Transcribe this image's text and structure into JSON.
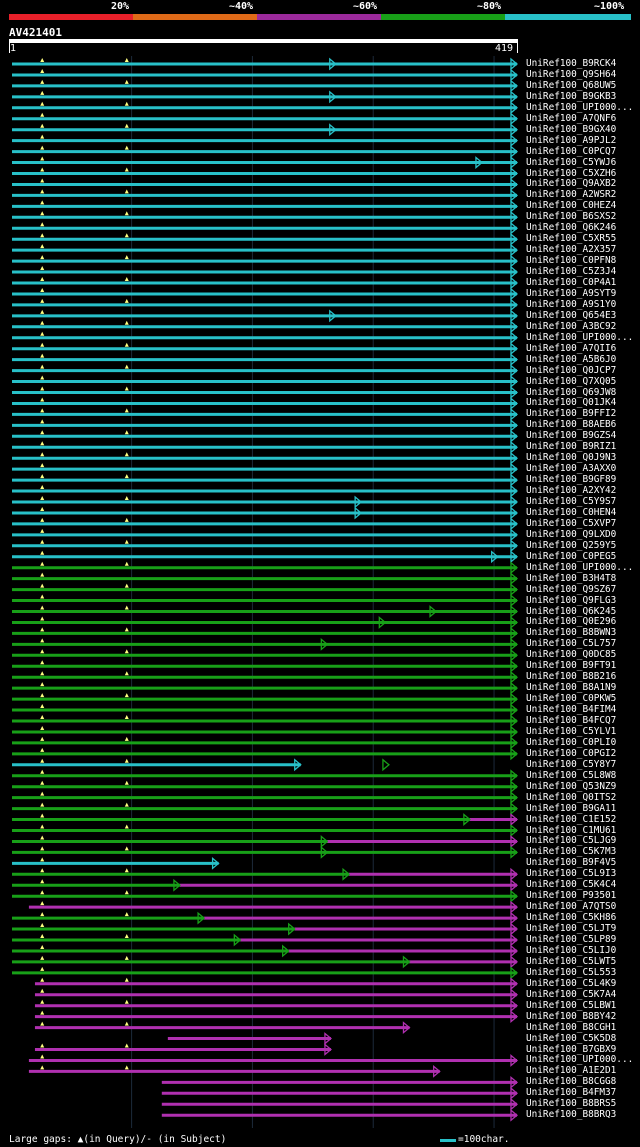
{
  "legend": {
    "percent_labels": [
      "20%",
      "~40%",
      "~60%",
      "~80%",
      "~100%"
    ],
    "band_colors": [
      "#e8202a",
      "#e06a18",
      "#9c2a9c",
      "#18a018",
      "#28c0c8"
    ]
  },
  "query": {
    "name": "AV421401",
    "start": "1",
    "end": "419"
  },
  "footer": {
    "gap_text": "Large gaps: ▲(in Query)/- (in Subject)",
    "scale_text": "=100char."
  },
  "chart_data": {
    "type": "alignment-overview",
    "query_length": 419,
    "hits": [
      {
        "name": "UniRef100_B9RCK4",
        "color": "cyan",
        "start": 1,
        "end": 419,
        "mid": 269
      },
      {
        "name": "UniRef100_Q9SH64",
        "color": "cyan",
        "start": 1,
        "end": 419
      },
      {
        "name": "UniRef100_Q68UW5",
        "color": "cyan",
        "start": 1,
        "end": 419
      },
      {
        "name": "UniRef100_B9GKB3",
        "color": "cyan",
        "start": 1,
        "end": 419,
        "mid": 269
      },
      {
        "name": "UniRef100_UPI000...",
        "color": "cyan",
        "start": 1,
        "end": 419
      },
      {
        "name": "UniRef100_A7QNF6",
        "color": "cyan",
        "start": 1,
        "end": 419
      },
      {
        "name": "UniRef100_B9GX40",
        "color": "cyan",
        "start": 1,
        "end": 419,
        "mid": 269
      },
      {
        "name": "UniRef100_A9PJL2",
        "color": "cyan",
        "start": 1,
        "end": 419
      },
      {
        "name": "UniRef100_C0PCQ7",
        "color": "cyan",
        "start": 1,
        "end": 419
      },
      {
        "name": "UniRef100_C5YWJ6",
        "color": "cyan",
        "start": 1,
        "end": 419,
        "mid": 390
      },
      {
        "name": "UniRef100_C5XZH6",
        "color": "cyan",
        "start": 1,
        "end": 419
      },
      {
        "name": "UniRef100_Q9AXB2",
        "color": "cyan",
        "start": 1,
        "end": 419
      },
      {
        "name": "UniRef100_A2WSR2",
        "color": "cyan",
        "start": 1,
        "end": 419
      },
      {
        "name": "UniRef100_C0HEZ4",
        "color": "cyan",
        "start": 1,
        "end": 419
      },
      {
        "name": "UniRef100_B6SXS2",
        "color": "cyan",
        "start": 1,
        "end": 419
      },
      {
        "name": "UniRef100_Q6K246",
        "color": "cyan",
        "start": 1,
        "end": 419
      },
      {
        "name": "UniRef100_C5XR55",
        "color": "cyan",
        "start": 1,
        "end": 419
      },
      {
        "name": "UniRef100_A2X357",
        "color": "cyan",
        "start": 1,
        "end": 419
      },
      {
        "name": "UniRef100_C0PFN8",
        "color": "cyan",
        "start": 1,
        "end": 419
      },
      {
        "name": "UniRef100_C5Z3J4",
        "color": "cyan",
        "start": 1,
        "end": 419
      },
      {
        "name": "UniRef100_C0P4A1",
        "color": "cyan",
        "start": 1,
        "end": 419
      },
      {
        "name": "UniRef100_A9SYT9",
        "color": "cyan",
        "start": 1,
        "end": 419
      },
      {
        "name": "UniRef100_A9S1Y0",
        "color": "cyan",
        "start": 1,
        "end": 419
      },
      {
        "name": "UniRef100_Q654E3",
        "color": "cyan",
        "start": 1,
        "end": 419,
        "mid": 269
      },
      {
        "name": "UniRef100_A3BC92",
        "color": "cyan",
        "start": 1,
        "end": 419
      },
      {
        "name": "UniRef100_UPI000...",
        "color": "cyan",
        "start": 1,
        "end": 419
      },
      {
        "name": "UniRef100_A7QII6",
        "color": "cyan",
        "start": 1,
        "end": 419
      },
      {
        "name": "UniRef100_A5B6J0",
        "color": "cyan",
        "start": 1,
        "end": 419
      },
      {
        "name": "UniRef100_Q0JCP7",
        "color": "cyan",
        "start": 1,
        "end": 419
      },
      {
        "name": "UniRef100_Q7XQ05",
        "color": "cyan",
        "start": 1,
        "end": 419
      },
      {
        "name": "UniRef100_Q69JW8",
        "color": "cyan",
        "start": 1,
        "end": 419
      },
      {
        "name": "UniRef100_Q01JK4",
        "color": "cyan",
        "start": 1,
        "end": 419
      },
      {
        "name": "UniRef100_B9FFI2",
        "color": "cyan",
        "start": 1,
        "end": 419
      },
      {
        "name": "UniRef100_B8AEB6",
        "color": "cyan",
        "start": 1,
        "end": 419
      },
      {
        "name": "UniRef100_B9GZS4",
        "color": "cyan",
        "start": 1,
        "end": 419
      },
      {
        "name": "UniRef100_B9RIZ1",
        "color": "cyan",
        "start": 1,
        "end": 419
      },
      {
        "name": "UniRef100_Q0J9N3",
        "color": "cyan",
        "start": 1,
        "end": 419
      },
      {
        "name": "UniRef100_A3AXX0",
        "color": "cyan",
        "start": 1,
        "end": 419
      },
      {
        "name": "UniRef100_B9GF89",
        "color": "cyan",
        "start": 1,
        "end": 419
      },
      {
        "name": "UniRef100_A2XY42",
        "color": "cyan",
        "start": 1,
        "end": 419
      },
      {
        "name": "UniRef100_C5Y9S7",
        "color": "cyan",
        "start": 1,
        "end": 419,
        "mid": 290
      },
      {
        "name": "UniRef100_C0HEN4",
        "color": "cyan",
        "start": 1,
        "end": 419,
        "mid": 290
      },
      {
        "name": "UniRef100_C5XVP7",
        "color": "cyan",
        "start": 1,
        "end": 419
      },
      {
        "name": "UniRef100_Q9LXD0",
        "color": "cyan",
        "start": 1,
        "end": 419
      },
      {
        "name": "UniRef100_Q259Y5",
        "color": "cyan",
        "start": 1,
        "end": 419
      },
      {
        "name": "UniRef100_C0PEG5",
        "color": "cyan",
        "start": 1,
        "end": 419,
        "mid": 403
      },
      {
        "name": "UniRef100_UPI000...",
        "color": "green",
        "start": 1,
        "end": 419
      },
      {
        "name": "UniRef100_B3H4T8",
        "color": "green",
        "start": 1,
        "end": 419
      },
      {
        "name": "UniRef100_Q9SZ67",
        "color": "green",
        "start": 1,
        "end": 419
      },
      {
        "name": "UniRef100_Q9FLG3",
        "color": "green",
        "start": 1,
        "end": 419
      },
      {
        "name": "UniRef100_Q6K245",
        "color": "green",
        "start": 1,
        "end": 419,
        "mid": 352
      },
      {
        "name": "UniRef100_Q0E296",
        "color": "green",
        "start": 1,
        "end": 419,
        "mid": 310
      },
      {
        "name": "UniRef100_B8BWN3",
        "color": "green",
        "start": 1,
        "end": 419
      },
      {
        "name": "UniRef100_C5L757",
        "color": "green",
        "start": 1,
        "end": 419,
        "mid": 262
      },
      {
        "name": "UniRef100_Q0DC85",
        "color": "green",
        "start": 1,
        "end": 419
      },
      {
        "name": "UniRef100_B9FT91",
        "color": "green",
        "start": 1,
        "end": 419
      },
      {
        "name": "UniRef100_B8B216",
        "color": "green",
        "start": 1,
        "end": 419
      },
      {
        "name": "UniRef100_B8A1N9",
        "color": "green",
        "start": 1,
        "end": 419
      },
      {
        "name": "UniRef100_C0PKW5",
        "color": "green",
        "start": 1,
        "end": 419
      },
      {
        "name": "UniRef100_B4FIM4",
        "color": "green",
        "start": 1,
        "end": 419
      },
      {
        "name": "UniRef100_B4FCQ7",
        "color": "green",
        "start": 1,
        "end": 419
      },
      {
        "name": "UniRef100_C5YLV1",
        "color": "green",
        "start": 1,
        "end": 419
      },
      {
        "name": "UniRef100_C0PLI0",
        "color": "green",
        "start": 1,
        "end": 419
      },
      {
        "name": "UniRef100_C0PGI2",
        "color": "green",
        "start": 1,
        "end": 419
      },
      {
        "name": "UniRef100_C5Y8Y7",
        "color": "cyan",
        "start": 1,
        "end": 240,
        "mid2": 313
      },
      {
        "name": "UniRef100_C5L8W8",
        "color": "green",
        "start": 1,
        "end": 419
      },
      {
        "name": "UniRef100_Q53NZ9",
        "color": "green",
        "start": 1,
        "end": 419
      },
      {
        "name": "UniRef100_Q0ITS2",
        "color": "green",
        "start": 1,
        "end": 419
      },
      {
        "name": "UniRef100_B9GA11",
        "color": "green",
        "start": 1,
        "end": 419
      },
      {
        "name": "UniRef100_C1E152",
        "color": "mix",
        "start": 1,
        "end": 419,
        "mid": 380
      },
      {
        "name": "UniRef100_C1MU61",
        "color": "green",
        "start": 1,
        "end": 419
      },
      {
        "name": "UniRef100_C5LJG9",
        "color": "mix",
        "start": 1,
        "end": 419,
        "mid": 262
      },
      {
        "name": "UniRef100_C5K7M3",
        "color": "green",
        "start": 1,
        "end": 419,
        "mid": 262
      },
      {
        "name": "UniRef100_B9F4V5",
        "color": "cyan",
        "start": 1,
        "end": 172
      },
      {
        "name": "UniRef100_C5L9I3",
        "color": "mix",
        "start": 1,
        "end": 419,
        "mid": 280
      },
      {
        "name": "UniRef100_C5K4C4",
        "color": "mix",
        "start": 1,
        "end": 419,
        "mid": 140
      },
      {
        "name": "UniRef100_P93501",
        "color": "green",
        "start": 1,
        "end": 419
      },
      {
        "name": "UniRef100_A7QTS0",
        "color": "magenta",
        "start": 15,
        "end": 419
      },
      {
        "name": "UniRef100_C5KH86",
        "color": "mix",
        "start": 1,
        "end": 419,
        "mid": 160
      },
      {
        "name": "UniRef100_C5LJT9",
        "color": "mix",
        "start": 1,
        "end": 419,
        "mid": 235
      },
      {
        "name": "UniRef100_C5LP89",
        "color": "mix",
        "start": 1,
        "end": 419,
        "mid": 190
      },
      {
        "name": "UniRef100_C5LIJ0",
        "color": "mix",
        "start": 1,
        "end": 419,
        "mid": 230
      },
      {
        "name": "UniRef100_C5LWT5",
        "color": "mix",
        "start": 1,
        "end": 419,
        "mid": 330
      },
      {
        "name": "UniRef100_C5L553",
        "color": "green",
        "start": 1,
        "end": 419
      },
      {
        "name": "UniRef100_C5L4K9",
        "color": "magenta",
        "start": 20,
        "end": 419
      },
      {
        "name": "UniRef100_C5K7A4",
        "color": "magenta",
        "start": 20,
        "end": 419
      },
      {
        "name": "UniRef100_C5LBW1",
        "color": "magenta",
        "start": 20,
        "end": 419
      },
      {
        "name": "UniRef100_B8BY42",
        "color": "magenta",
        "start": 20,
        "end": 419
      },
      {
        "name": "UniRef100_B8CGH1",
        "color": "magenta",
        "start": 20,
        "end": 330
      },
      {
        "name": "UniRef100_C5K5D8",
        "color": "magenta",
        "start": 130,
        "end": 265
      },
      {
        "name": "UniRef100_B7GBX9",
        "color": "magenta",
        "start": 20,
        "end": 265
      },
      {
        "name": "UniRef100_UPI000...",
        "color": "magenta",
        "start": 15,
        "end": 419
      },
      {
        "name": "UniRef100_A1E2D1",
        "color": "magenta",
        "start": 15,
        "end": 355
      },
      {
        "name": "UniRef100_B8CGG8",
        "color": "magenta",
        "start": 125,
        "end": 419
      },
      {
        "name": "UniRef100_B4FM37",
        "color": "magenta",
        "start": 125,
        "end": 419
      },
      {
        "name": "UniRef100_B8BRS5",
        "color": "magenta",
        "start": 125,
        "end": 419
      },
      {
        "name": "UniRef100_B8BRQ3",
        "color": "magenta",
        "start": 125,
        "end": 419
      }
    ]
  }
}
